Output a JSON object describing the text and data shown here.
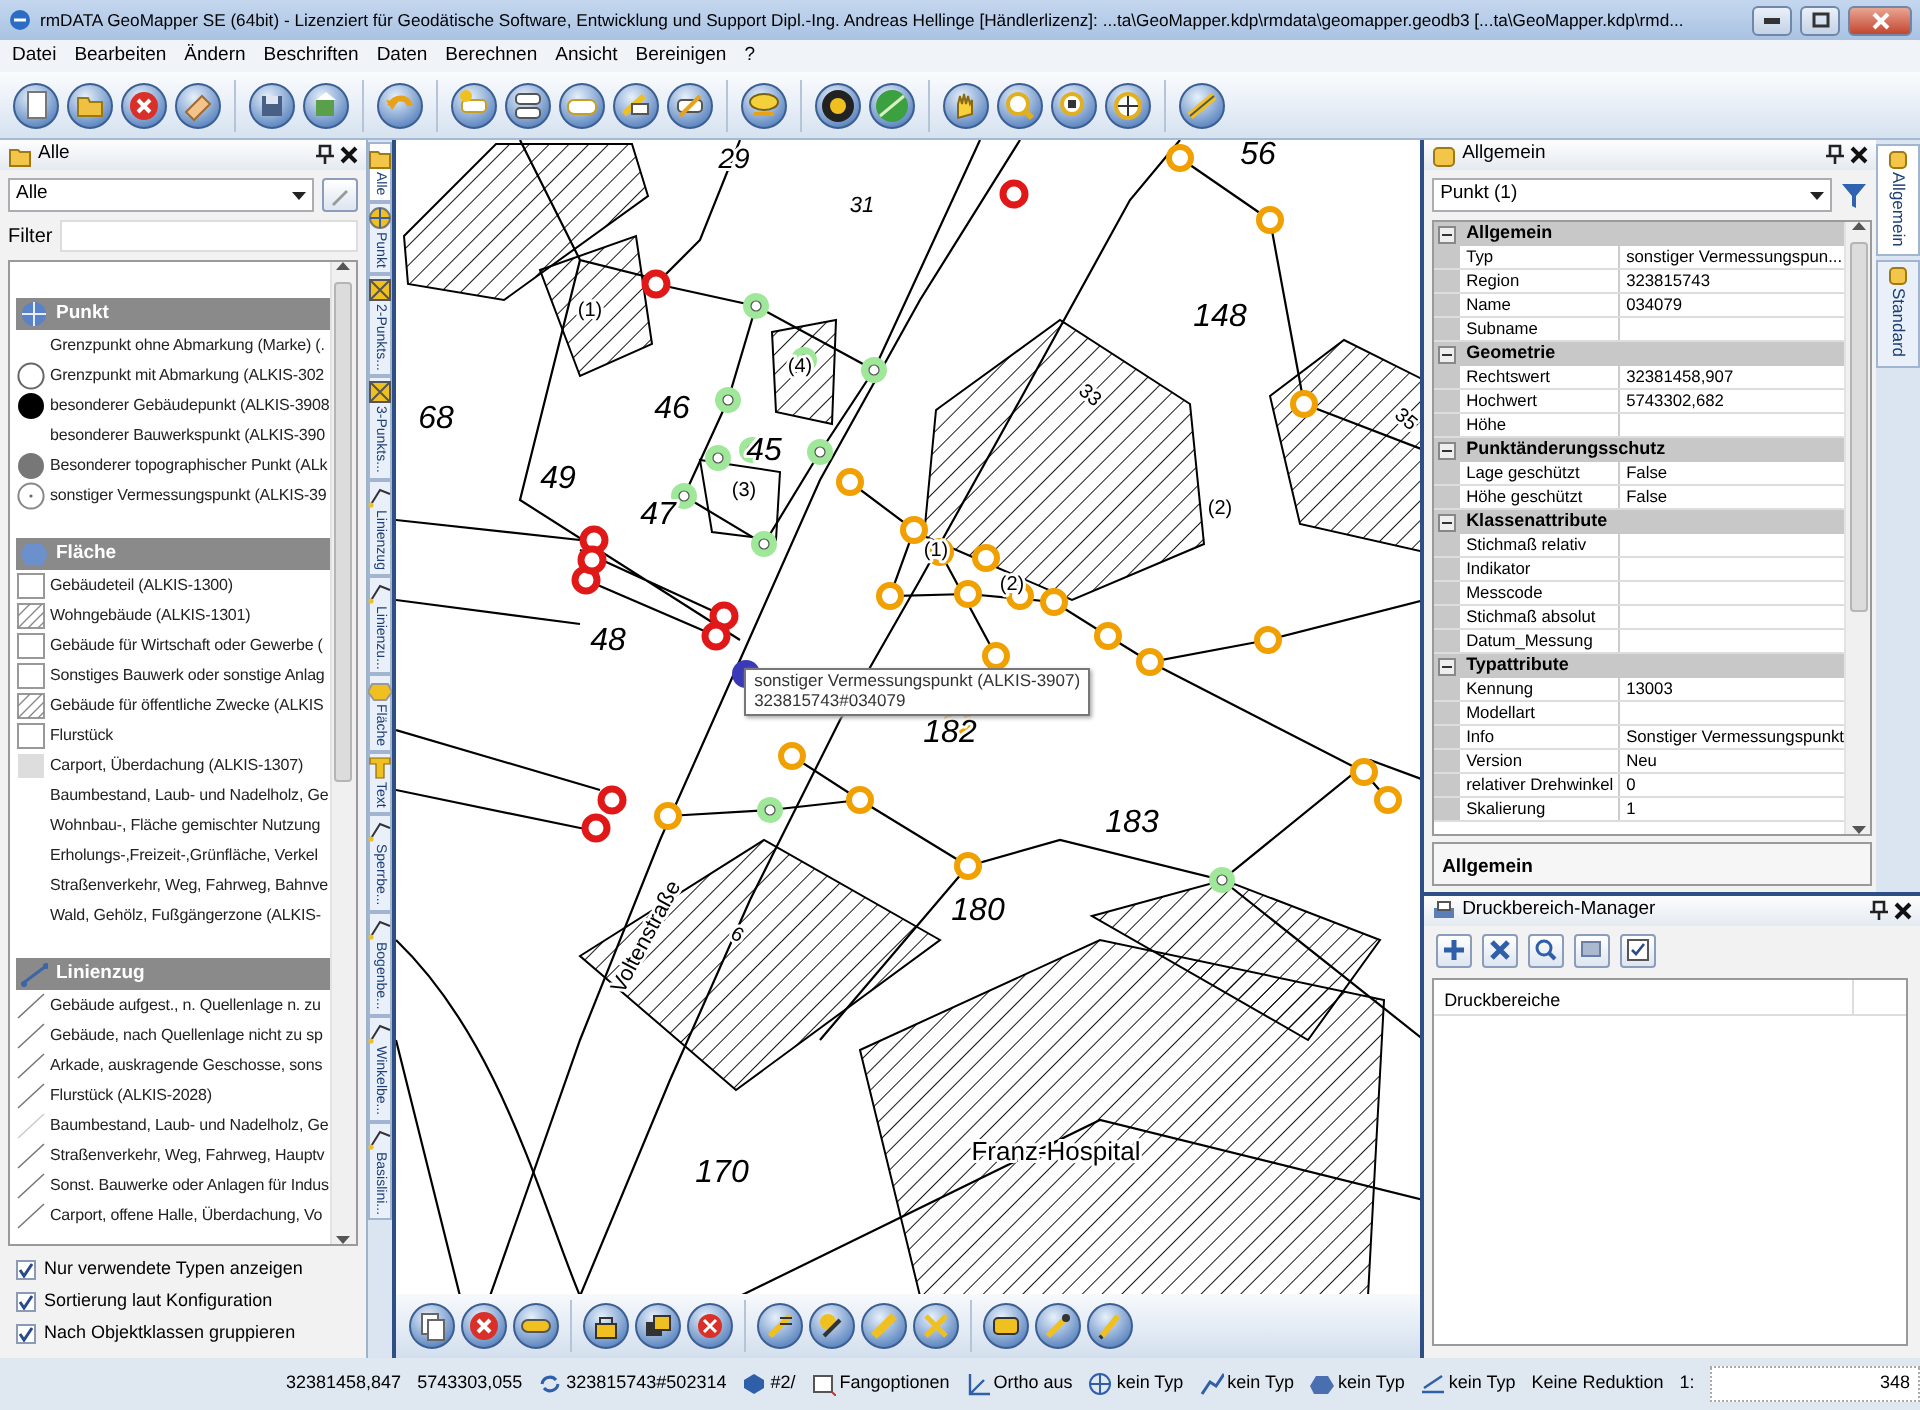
{
  "window": {
    "title": "rmDATA GeoMapper SE (64bit) - Lizenziert für Geodätische Software, Entwicklung und Support Dipl.-Ing. Andreas Hellinge [Händlerlizenz]: ...ta\\GeoMapper.kdp\\rmdata\\geomapper.geodb3 [...ta\\GeoMapper.kdp\\rmd..."
  },
  "menu": [
    "Datei",
    "Bearbeiten",
    "Ändern",
    "Beschriften",
    "Daten",
    "Berechnen",
    "Ansicht",
    "Bereinigen",
    "?"
  ],
  "left_panel": {
    "title": "Alle",
    "selector": "Alle",
    "filter_label": "Filter",
    "groups": [
      {
        "name": "Punkt",
        "kind": "point",
        "items": [
          {
            "label": "Grenzpunkt ohne Abmarkung (Marke) (.",
            "kind": "none"
          },
          {
            "label": "Grenzpunkt mit Abmarkung (ALKIS-302",
            "kind": "circle-open"
          },
          {
            "label": "besonderer Gebäudepunkt (ALKIS-3908",
            "kind": "circle-filled"
          },
          {
            "label": "besonderer Bauwerkspunkt (ALKIS-390",
            "kind": "none"
          },
          {
            "label": "Besonderer topographischer Punkt (ALk",
            "kind": "circle-grey"
          },
          {
            "label": "sonstiger Vermessungspunkt (ALKIS-39",
            "kind": "circle-dot"
          }
        ]
      },
      {
        "name": "Fläche",
        "kind": "area",
        "items": [
          {
            "label": "Gebäudeteil (ALKIS-1300)",
            "kind": "square"
          },
          {
            "label": "Wohngebäude (ALKIS-1301)",
            "kind": "square-hatched"
          },
          {
            "label": "Gebäude für Wirtschaft oder Gewerbe (",
            "kind": "square"
          },
          {
            "label": "Sonstiges Bauwerk oder sonstige Anlag",
            "kind": "square"
          },
          {
            "label": "Gebäude für öffentliche Zwecke (ALKIS",
            "kind": "square-hatched"
          },
          {
            "label": "Flurstück",
            "kind": "square"
          },
          {
            "label": "Carport, Überdachung (ALKIS-1307)",
            "kind": "square-grey"
          },
          {
            "label": "Baumbestand, Laub- und Nadelholz, Ge",
            "kind": "none"
          },
          {
            "label": "Wohnbau-, Fläche gemischter Nutzung",
            "kind": "none"
          },
          {
            "label": "Erholungs-,Freizeit-,Grünfläche, Verkel",
            "kind": "none"
          },
          {
            "label": "Straßenverkehr, Weg, Fahrweg, Bahnve",
            "kind": "none"
          },
          {
            "label": "Wald, Gehölz, Fußgängerzone (ALKIS-",
            "kind": "none"
          }
        ]
      },
      {
        "name": "Linienzug",
        "kind": "line",
        "items": [
          {
            "label": "Gebäude aufgest., n. Quellenlage n. zu",
            "kind": "line"
          },
          {
            "label": "Gebäude, nach Quellenlage nicht zu sp",
            "kind": "line"
          },
          {
            "label": "Arkade, auskragende Geschosse, sons",
            "kind": "line"
          },
          {
            "label": "Flurstück (ALKIS-2028)",
            "kind": "line"
          },
          {
            "label": "Baumbestand, Laub- und Nadelholz, Ge",
            "kind": "line-faint"
          },
          {
            "label": "Straßenverkehr, Weg, Fahrweg, Hauptv",
            "kind": "line"
          },
          {
            "label": "Sonst. Bauwerke oder Anlagen für Indus",
            "kind": "line"
          },
          {
            "label": "Carport, offene Halle, Überdachung, Vo",
            "kind": "line"
          }
        ]
      }
    ],
    "options": [
      {
        "label": "Nur verwendete Typen anzeigen",
        "checked": true
      },
      {
        "label": "Sortierung laut Konfiguration",
        "checked": true
      },
      {
        "label": "Nach Objektklassen gruppieren",
        "checked": true
      }
    ]
  },
  "side_tabs": [
    {
      "label": "Alle",
      "kind": "folder",
      "selected": true
    },
    {
      "label": "Punkt",
      "kind": "point",
      "selected": false
    },
    {
      "label": "2-Punkts...",
      "kind": "cross",
      "selected": false
    },
    {
      "label": "3-Punkts...",
      "kind": "cross",
      "selected": false
    },
    {
      "label": "Linienzug",
      "kind": "line",
      "selected": false
    },
    {
      "label": "Linienzu...",
      "kind": "line",
      "selected": false
    },
    {
      "label": "Fläche",
      "kind": "area",
      "selected": false
    },
    {
      "label": "Text",
      "kind": "text",
      "selected": false
    },
    {
      "label": "Sperrbe...",
      "kind": "line",
      "selected": false
    },
    {
      "label": "Bogenbe...",
      "kind": "line",
      "selected": false
    },
    {
      "label": "Winkelbe...",
      "kind": "line",
      "selected": false
    },
    {
      "label": "Basislini...",
      "kind": "line",
      "selected": false
    }
  ],
  "map": {
    "labels": [
      {
        "text": "29",
        "kind": "parcel"
      },
      {
        "text": "31",
        "kind": "parcel"
      },
      {
        "text": "56",
        "kind": "parcel"
      },
      {
        "text": "148",
        "kind": "parcel"
      },
      {
        "text": "68",
        "kind": "parcel"
      },
      {
        "text": "46",
        "kind": "parcel"
      },
      {
        "text": "45",
        "kind": "parcel"
      },
      {
        "text": "49",
        "kind": "parcel"
      },
      {
        "text": "47",
        "kind": "parcel"
      },
      {
        "text": "48",
        "kind": "parcel"
      },
      {
        "text": "33",
        "kind": "house"
      },
      {
        "text": "35",
        "kind": "house"
      },
      {
        "text": "182",
        "kind": "parcel"
      },
      {
        "text": "183",
        "kind": "parcel"
      },
      {
        "text": "180",
        "kind": "parcel"
      },
      {
        "text": "170",
        "kind": "parcel"
      },
      {
        "text": "Franz-Hospital",
        "kind": "building"
      },
      {
        "text": "Voltenstraße",
        "kind": "street"
      },
      {
        "text": "(1)",
        "kind": "part"
      },
      {
        "text": "(4)",
        "kind": "part"
      },
      {
        "text": "(3)",
        "kind": "part"
      },
      {
        "text": "(1)",
        "kind": "part"
      },
      {
        "text": "(2)",
        "kind": "part"
      },
      {
        "text": "(2)",
        "kind": "part"
      },
      {
        "text": "6",
        "kind": "house"
      }
    ],
    "tooltip": {
      "title": "sonstiger Vermessungspunkt (ALKIS-3907)",
      "id": "323815743#034079"
    }
  },
  "properties": {
    "title": "Allgemein",
    "selector": "Punkt (1)",
    "categories": [
      {
        "name": "Allgemein",
        "expanded": true,
        "rows": [
          {
            "name": "Typ",
            "value": "sonstiger Vermessungspun..."
          },
          {
            "name": "Region",
            "value": "323815743"
          },
          {
            "name": "Name",
            "value": "034079"
          },
          {
            "name": "Subname"
          }
        ]
      },
      {
        "name": "Geometrie",
        "expanded": true,
        "rows": [
          {
            "name": "Rechtswert",
            "value": "32381458,907"
          },
          {
            "name": "Hochwert",
            "value": "5743302,682"
          },
          {
            "name": "Höhe"
          }
        ]
      },
      {
        "name": "Punktänderungsschutz",
        "expanded": true,
        "rows": [
          {
            "name": "Lage geschützt",
            "value": "False"
          },
          {
            "name": "Höhe geschützt",
            "value": "False"
          }
        ]
      },
      {
        "name": "Klassenattribute",
        "expanded": true,
        "rows": [
          {
            "name": "Stichmaß relativ"
          },
          {
            "name": "Indikator"
          },
          {
            "name": "Messcode"
          },
          {
            "name": "Stichmaß absolut"
          },
          {
            "name": "Datum_Messung"
          }
        ]
      },
      {
        "name": "Typattribute",
        "expanded": true,
        "rows": [
          {
            "name": "Kennung",
            "value": "13003"
          },
          {
            "name": "Modellart"
          },
          {
            "name": "Info",
            "value": "Sonstiger Vermessungspunkt"
          },
          {
            "name": "Version",
            "value": "Neu"
          },
          {
            "name": "relativer Drehwinkel",
            "value": "0"
          },
          {
            "name": "Skalierung",
            "value": "1"
          }
        ]
      }
    ],
    "description": "Allgemein",
    "side_tabs": [
      {
        "label": "Allgemein",
        "selected": true
      },
      {
        "label": "Standard",
        "selected": false
      }
    ]
  },
  "print_manager": {
    "title": "Druckbereich-Manager",
    "column": "Druckbereiche"
  },
  "status_bar": [
    {
      "kind": "plain",
      "text": "32381458,847"
    },
    {
      "kind": "plain",
      "text": "5743303,055"
    },
    {
      "kind": "region",
      "text": "323815743#502314"
    },
    {
      "kind": "layer",
      "text": "#2/"
    },
    {
      "kind": "snap",
      "text": "Fangoptionen"
    },
    {
      "kind": "ortho",
      "text": "Ortho aus"
    },
    {
      "kind": "point",
      "text": "kein Typ"
    },
    {
      "kind": "line",
      "text": "kein Typ"
    },
    {
      "kind": "area",
      "text": "kein Typ"
    },
    {
      "kind": "text-type",
      "text": "kein Typ"
    },
    {
      "kind": "plain",
      "text": "Keine Reduktion"
    },
    {
      "kind": "plain",
      "text": "1:"
    },
    {
      "kind": "field",
      "text": "348"
    }
  ]
}
